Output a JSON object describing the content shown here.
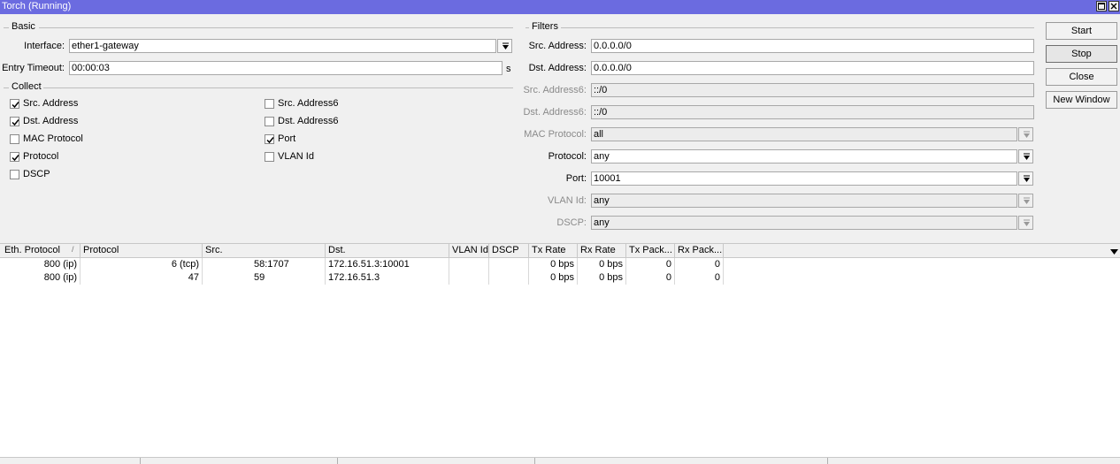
{
  "window": {
    "title": "Torch (Running)"
  },
  "basic": {
    "section_label": "Basic",
    "interface_label": "Interface:",
    "interface_value": "ether1-gateway",
    "entry_timeout_label": "Entry Timeout:",
    "entry_timeout_value": "00:00:03",
    "entry_timeout_unit": "s"
  },
  "collect": {
    "section_label": "Collect",
    "items": [
      {
        "label": "Src. Address",
        "checked": true
      },
      {
        "label": "Dst. Address",
        "checked": true
      },
      {
        "label": "MAC Protocol",
        "checked": false
      },
      {
        "label": "Protocol",
        "checked": true
      },
      {
        "label": "DSCP",
        "checked": false
      },
      {
        "label": "Src. Address6",
        "checked": false
      },
      {
        "label": "Dst. Address6",
        "checked": false
      },
      {
        "label": "Port",
        "checked": true
      },
      {
        "label": "VLAN Id",
        "checked": false
      }
    ]
  },
  "filters": {
    "section_label": "Filters",
    "src_address": {
      "label": "Src. Address:",
      "value": "0.0.0.0/0"
    },
    "dst_address": {
      "label": "Dst. Address:",
      "value": "0.0.0.0/0"
    },
    "src_address6": {
      "label": "Src. Address6:",
      "value": "::/0"
    },
    "dst_address6": {
      "label": "Dst. Address6:",
      "value": "::/0"
    },
    "mac_protocol": {
      "label": "MAC Protocol:",
      "value": "all"
    },
    "protocol": {
      "label": "Protocol:",
      "value": "any"
    },
    "port": {
      "label": "Port:",
      "value": "10001"
    },
    "vlan_id": {
      "label": "VLAN Id:",
      "value": "any"
    },
    "dscp": {
      "label": "DSCP:",
      "value": "any"
    }
  },
  "buttons": {
    "start": "Start",
    "stop": "Stop",
    "close": "Close",
    "new_window": "New Window"
  },
  "table": {
    "sort_indicator": "/",
    "columns": [
      "Eth. Protocol",
      "Protocol",
      "Src.",
      "Dst.",
      "VLAN Id",
      "DSCP",
      "Tx Rate",
      "Rx Rate",
      "Tx Pack...",
      "Rx Pack..."
    ],
    "rows": [
      [
        "800 (ip)",
        "6 (tcp)",
        "58:1707",
        "172.16.51.3:10001",
        "",
        "",
        "0 bps",
        "0 bps",
        "0",
        "0"
      ],
      [
        "800 (ip)",
        "47",
        "59",
        "172.16.51.3",
        "",
        "",
        "0 bps",
        "0 bps",
        "0",
        "0"
      ]
    ]
  },
  "colors": {
    "titlebar": "#6b6be0",
    "panel": "#f0f0f0",
    "table_bg": "#ffffff"
  }
}
